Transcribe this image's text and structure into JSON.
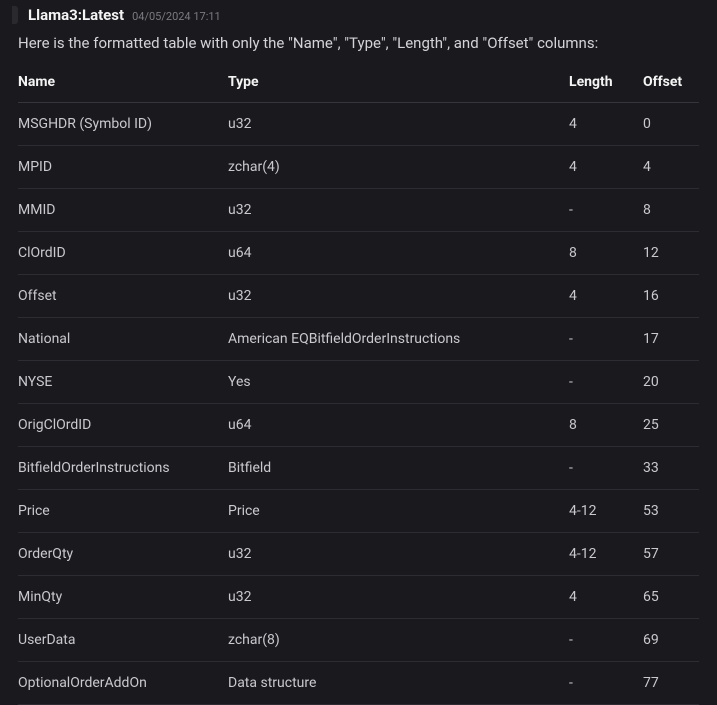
{
  "header": {
    "model": "Llama3:Latest",
    "timestamp": "04/05/2024 17:11"
  },
  "intro": "Here is the formatted table with only the \"Name\", \"Type\", \"Length\", and \"Offset\" columns:",
  "table": {
    "headers": {
      "name": "Name",
      "type": "Type",
      "length": "Length",
      "offset": "Offset"
    },
    "rows": [
      {
        "name": "MSGHDR (Symbol ID)",
        "type": "u32",
        "length": "4",
        "offset": "0"
      },
      {
        "name": "MPID",
        "type": "zchar(4)",
        "length": "4",
        "offset": "4"
      },
      {
        "name": "MMID",
        "type": "u32",
        "length": "-",
        "offset": "8"
      },
      {
        "name": "ClOrdID",
        "type": "u64",
        "length": "8",
        "offset": "12"
      },
      {
        "name": "Offset",
        "type": "u32",
        "length": "4",
        "offset": "16"
      },
      {
        "name": "National",
        "type": "American EQBitfieldOrderInstructions",
        "length": "-",
        "offset": "17"
      },
      {
        "name": "NYSE",
        "type": "Yes",
        "length": "-",
        "offset": "20"
      },
      {
        "name": "OrigClOrdID",
        "type": "u64",
        "length": "8",
        "offset": "25"
      },
      {
        "name": "BitfieldOrderInstructions",
        "type": "Bitfield",
        "length": "-",
        "offset": "33"
      },
      {
        "name": "Price",
        "type": "Price",
        "length": "4-12",
        "offset": "53"
      },
      {
        "name": "OrderQty",
        "type": "u32",
        "length": "4-12",
        "offset": "57"
      },
      {
        "name": "MinQty",
        "type": "u32",
        "length": "4",
        "offset": "65"
      },
      {
        "name": "UserData",
        "type": "zchar(8)",
        "length": "-",
        "offset": "69"
      },
      {
        "name": "OptionalOrderAddOn",
        "type": "Data structure",
        "length": "-",
        "offset": "77"
      }
    ]
  }
}
